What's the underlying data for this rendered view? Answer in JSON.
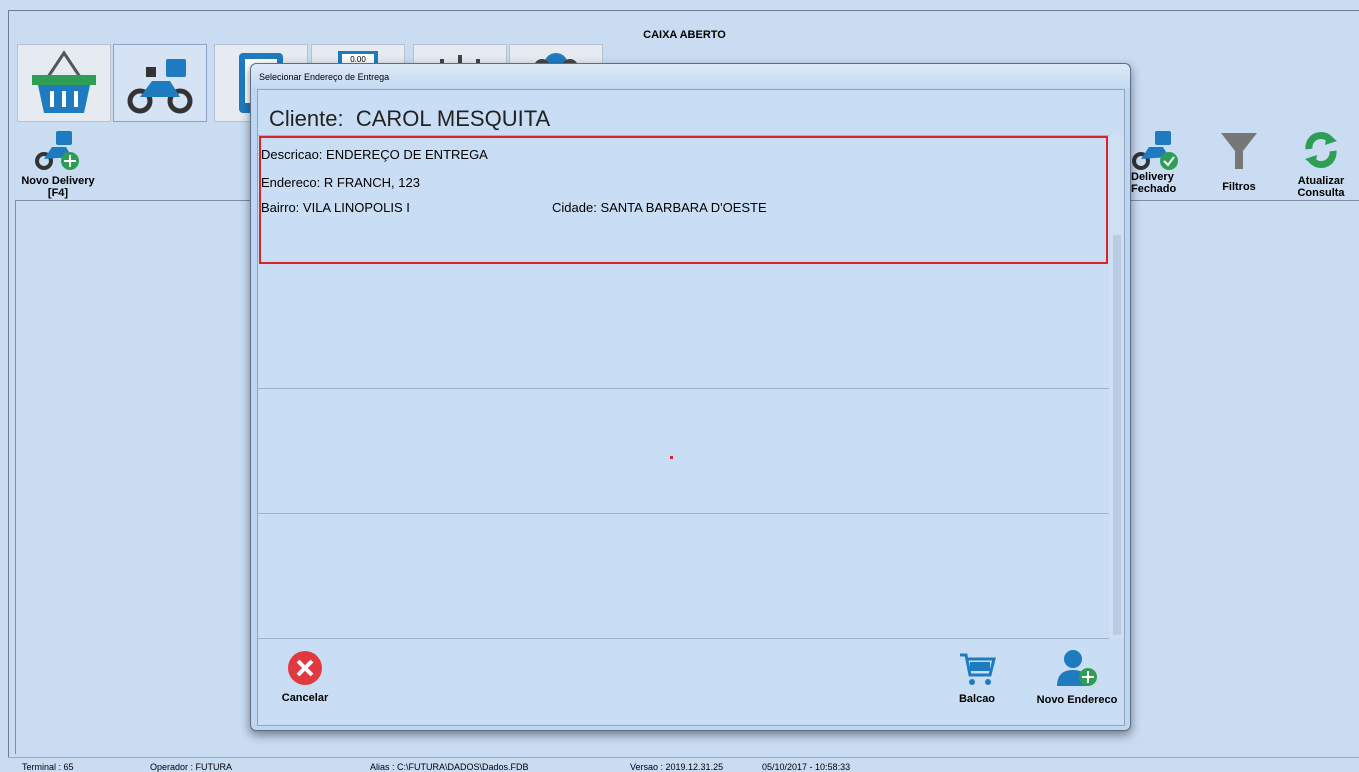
{
  "window": {
    "title": "CAIXA ABERTO"
  },
  "top_tabs": [
    {
      "icon": "basket-icon"
    },
    {
      "icon": "delivery-motorcycle-icon",
      "active": true
    },
    {
      "icon": "tablet-icon"
    },
    {
      "icon": "cash-register-icon"
    },
    {
      "icon": "sliders-icon"
    },
    {
      "icon": "users-icon"
    }
  ],
  "toolbar": {
    "novo_delivery_line1": "Novo Delivery",
    "novo_delivery_line2": "[F4]",
    "delivery_fechado_line1": "Delivery",
    "delivery_fechado_line2": "Fechado",
    "filtros": "Filtros",
    "atualizar_line1": "Atualizar",
    "atualizar_line2": "Consulta"
  },
  "dialog": {
    "title": "Selecionar Endereço de Entrega",
    "client_label": "Cliente:",
    "client_name": "CAROL MESQUITA",
    "addresses": [
      {
        "descricao_label": "Descricao:",
        "descricao": "ENDEREÇO DE ENTREGA",
        "endereco_label": "Endereco:",
        "endereco": "R FRANCH, 123",
        "bairro_label": "Bairro:",
        "bairro": "VILA LINOPOLIS I",
        "cidade_label": "Cidade:",
        "cidade": "SANTA BARBARA D'OESTE"
      }
    ],
    "buttons": {
      "cancelar": "Cancelar",
      "balcao": "Balcao",
      "novo_endereco": "Novo Endereco"
    }
  },
  "statusbar": {
    "terminal": "Terminal : 65",
    "operador": "Operador : FUTURA",
    "alias": "Alias : C:\\FUTURA\\DADOS\\Dados.FDB",
    "versao": "Versao : 2019.12.31.25",
    "datetime": "05/10/2017 - 10:58:33"
  },
  "colors": {
    "accent": "#1f7bbf",
    "green": "#2e9e55",
    "cancel_red": "#e2383f",
    "selection_border": "#d9242a"
  }
}
